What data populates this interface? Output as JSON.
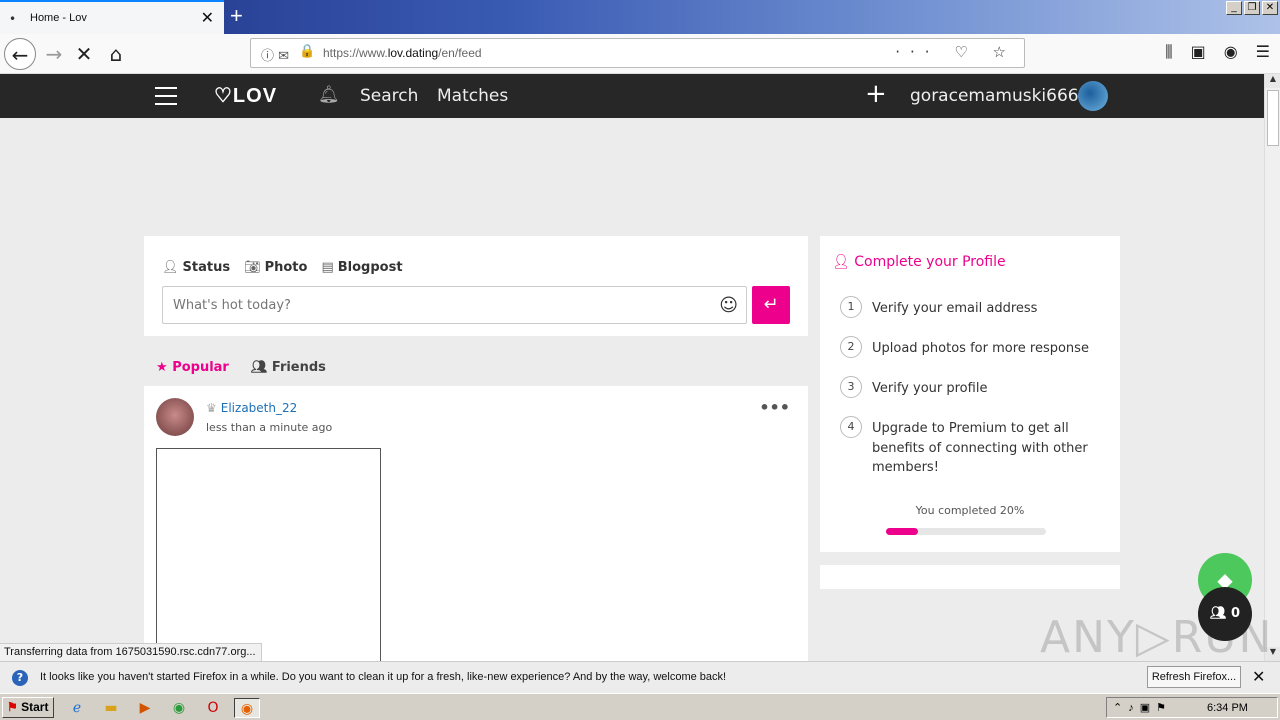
{
  "browser": {
    "tab_title": "Home - Lov",
    "tab_dot": "•",
    "url_prefix": "https://www.",
    "url_domain": "lov.dating",
    "url_path": "/en/feed",
    "new_tab": "+",
    "status_text": "Transferring data from 1675031590.rsc.cdn77.org..."
  },
  "site": {
    "logo": "♡LOV",
    "nav_search": "Search",
    "nav_matches": "Matches",
    "username": "goracemamuski666"
  },
  "composer": {
    "tab_status": "Status",
    "tab_photo": "Photo",
    "tab_blogpost": "Blogpost",
    "placeholder": "What's hot today?"
  },
  "feed": {
    "tab_popular": "Popular",
    "tab_friends": "Friends",
    "post": {
      "author": "Elizabeth_22",
      "time": "less than a minute ago"
    }
  },
  "profile": {
    "title": "Complete your Profile",
    "steps": [
      {
        "num": "1",
        "text": "Verify your email address"
      },
      {
        "num": "2",
        "text": "Upload photos for more response"
      },
      {
        "num": "3",
        "text": "Verify your profile"
      },
      {
        "num": "4",
        "text": "Upgrade to Premium to get all benefits of connecting with other members!"
      }
    ],
    "progress_label": "You completed 20%",
    "progress_fraction": 0.2
  },
  "fab": {
    "friends_count": "0"
  },
  "watermark": "ANY▷RUN",
  "notification": {
    "message": "It looks like you haven't started Firefox in a while. Do you want to clean it up for a fresh, like-new experience? And by the way, welcome back!",
    "button": "Refresh Firefox..."
  },
  "taskbar": {
    "start": "Start",
    "clock": "6:34 PM"
  },
  "colors": {
    "accent": "#ec008c",
    "header": "#272727",
    "link": "#1c6fb5"
  }
}
